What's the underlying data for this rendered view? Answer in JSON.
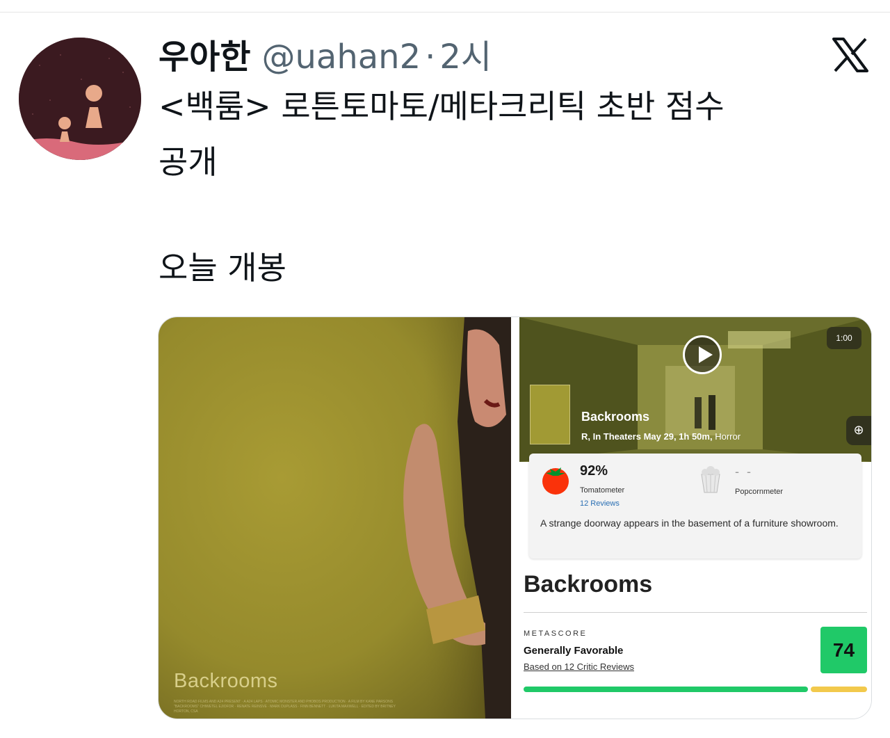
{
  "tweet": {
    "author_name": "우아한",
    "handle": "@uahan2",
    "separator": "·",
    "time": "2시",
    "text_line1": "<백룸> 로튼토마토/메타크리틱 초반 점수",
    "text_line2": "공개",
    "text_line3": "오늘 개봉"
  },
  "poster": {
    "title": "Backrooms",
    "credits": "NORTH ROAD FILMS AND A24 PRESENT · A A24 LAPS · ATOMIC MONSTER AND PHOBOS PRODUCTION · A FILM BY KANE PARSONS \"BACKROOMS\" CHIWETEL EJIOFOR · RENATE REINSVE · MARK DUPLASS · FINN BENNETT · LUKITA MAXWELL · EDITED BY BRITNEY HORTON, CSA"
  },
  "trailer": {
    "duration": "1:00",
    "title": "Backrooms",
    "meta_bold": "R, In Theaters May 29, 1h 50m,",
    "meta_genre": "Horror",
    "add_icon": "plus-circle-icon"
  },
  "rotten_tomatoes": {
    "score": "92%",
    "score_label": "Tomatometer",
    "reviews": "12 Reviews",
    "popcorn_score": "- -",
    "popcorn_label": "Popcornmeter",
    "synopsis": "A strange doorway appears in the basement of a furniture showroom."
  },
  "metacritic": {
    "title": "Backrooms",
    "label": "METASCORE",
    "verdict": "Generally Favorable",
    "based_on": "Based on 12 Critic Reviews",
    "score": "74",
    "score_color": "#20c968",
    "bar_positive_color": "#20c968",
    "bar_mixed_color": "#f2c94c"
  },
  "colors": {
    "text_primary": "#0f1419",
    "text_secondary": "#536471"
  }
}
